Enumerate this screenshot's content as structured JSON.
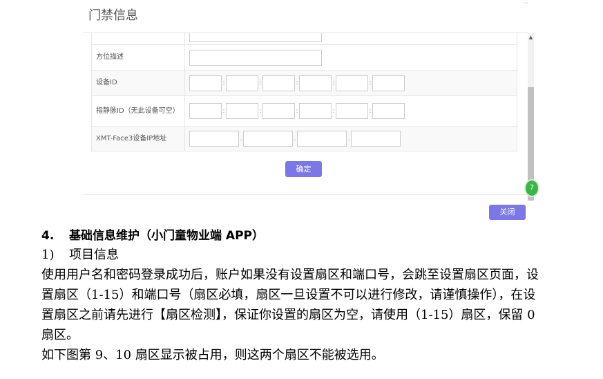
{
  "dialog": {
    "title": "门禁信息",
    "rows": [
      {
        "label": "方位描述"
      },
      {
        "label": "设备ID"
      },
      {
        "label": "指静脉ID（无此设备可空）"
      },
      {
        "label": "XMT-Face3设备IP地址"
      }
    ],
    "confirm_label": "确定",
    "close_label": "关闭",
    "badge_text": "7"
  },
  "document": {
    "heading_num": "4.",
    "heading_text": "基础信息维护（小门童物业端 APP）",
    "sub_num": "1)",
    "sub_text": "项目信息",
    "paragraph_lines": [
      "使用用户名和密码登录成功后，账户如果没有设置扇区和端口号，会跳至设置扇区页面，设",
      "置扇区（1-15）和端口号（扇区必填，扇区一旦设置不可以进行修改，请谨慎操作），在设",
      "置扇区之前请先进行【扇区检测】，保证你设置的扇区为空，请使用（1-15）扇区，保留 0",
      "扇区。",
      "如下图第 9、10 扇区显示被占用，则这两个扇区不能被选用。"
    ]
  }
}
